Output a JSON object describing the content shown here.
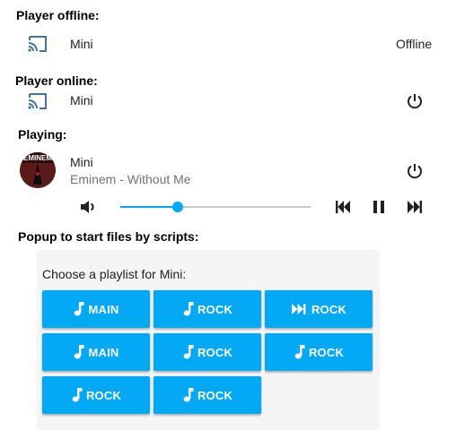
{
  "sections": {
    "offline_title": "Player offline:",
    "online_title": "Player online:",
    "playing_title": "Playing:",
    "popup_title": "Popup to start files by scripts:"
  },
  "offline_player": {
    "name": "Mini",
    "state": "Offline",
    "icon": "cast-icon"
  },
  "online_player": {
    "name": "Mini",
    "icon": "cast-icon",
    "action_icon": "power-icon"
  },
  "playing_player": {
    "name": "Mini",
    "media": "Eminem - Without Me",
    "album_art_text": "EMINEM",
    "volume_level": 0.3,
    "controls": [
      "previous-icon",
      "pause-icon",
      "next-icon"
    ]
  },
  "popup": {
    "label": "Choose a playlist for Mini:",
    "buttons": [
      {
        "label": "MAIN",
        "icon": "music-note-icon"
      },
      {
        "label": "ROCK",
        "icon": "music-note-icon"
      },
      {
        "label": "ROCK",
        "icon": "skip-next-icon"
      },
      {
        "label": "MAIN",
        "icon": "music-note-icon"
      },
      {
        "label": "ROCK",
        "icon": "music-note-icon"
      },
      {
        "label": "ROCK",
        "icon": "music-note-icon"
      },
      {
        "label": "ROCK",
        "icon": "music-note-icon"
      },
      {
        "label": "ROCK",
        "icon": "music-note-icon"
      }
    ]
  },
  "colors": {
    "accent": "#03a9f4",
    "icon": "#44739e",
    "popup_bg": "#f5f5f5"
  }
}
